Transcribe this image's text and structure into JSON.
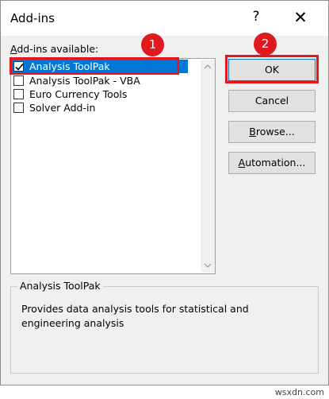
{
  "dialog": {
    "title": "Add-ins",
    "help_label": "?",
    "close_label": "✕"
  },
  "addins": {
    "label_prefix": "",
    "label_access": "A",
    "label_rest": "dd-ins available:",
    "items": [
      {
        "label": "Analysis ToolPak",
        "checked": true,
        "selected": true
      },
      {
        "label": "Analysis ToolPak - VBA",
        "checked": false,
        "selected": false
      },
      {
        "label": "Euro Currency Tools",
        "checked": false,
        "selected": false
      },
      {
        "label": "Solver Add-in",
        "checked": false,
        "selected": false
      }
    ]
  },
  "buttons": {
    "ok": "OK",
    "cancel": "Cancel",
    "browse_access": "B",
    "browse_rest": "rowse...",
    "automation_access": "A",
    "automation_rest": "utomation..."
  },
  "description": {
    "title": "Analysis ToolPak",
    "text": "Provides data analysis tools for statistical and engineering analysis"
  },
  "annotations": {
    "badge1": "1",
    "badge2": "2",
    "color": "#e0191e"
  },
  "watermark": "wsxdn.com",
  "colors": {
    "selection": "#0078d7",
    "dialog_bg": "#f0f0f0",
    "button_bg": "#e1e1e1"
  }
}
